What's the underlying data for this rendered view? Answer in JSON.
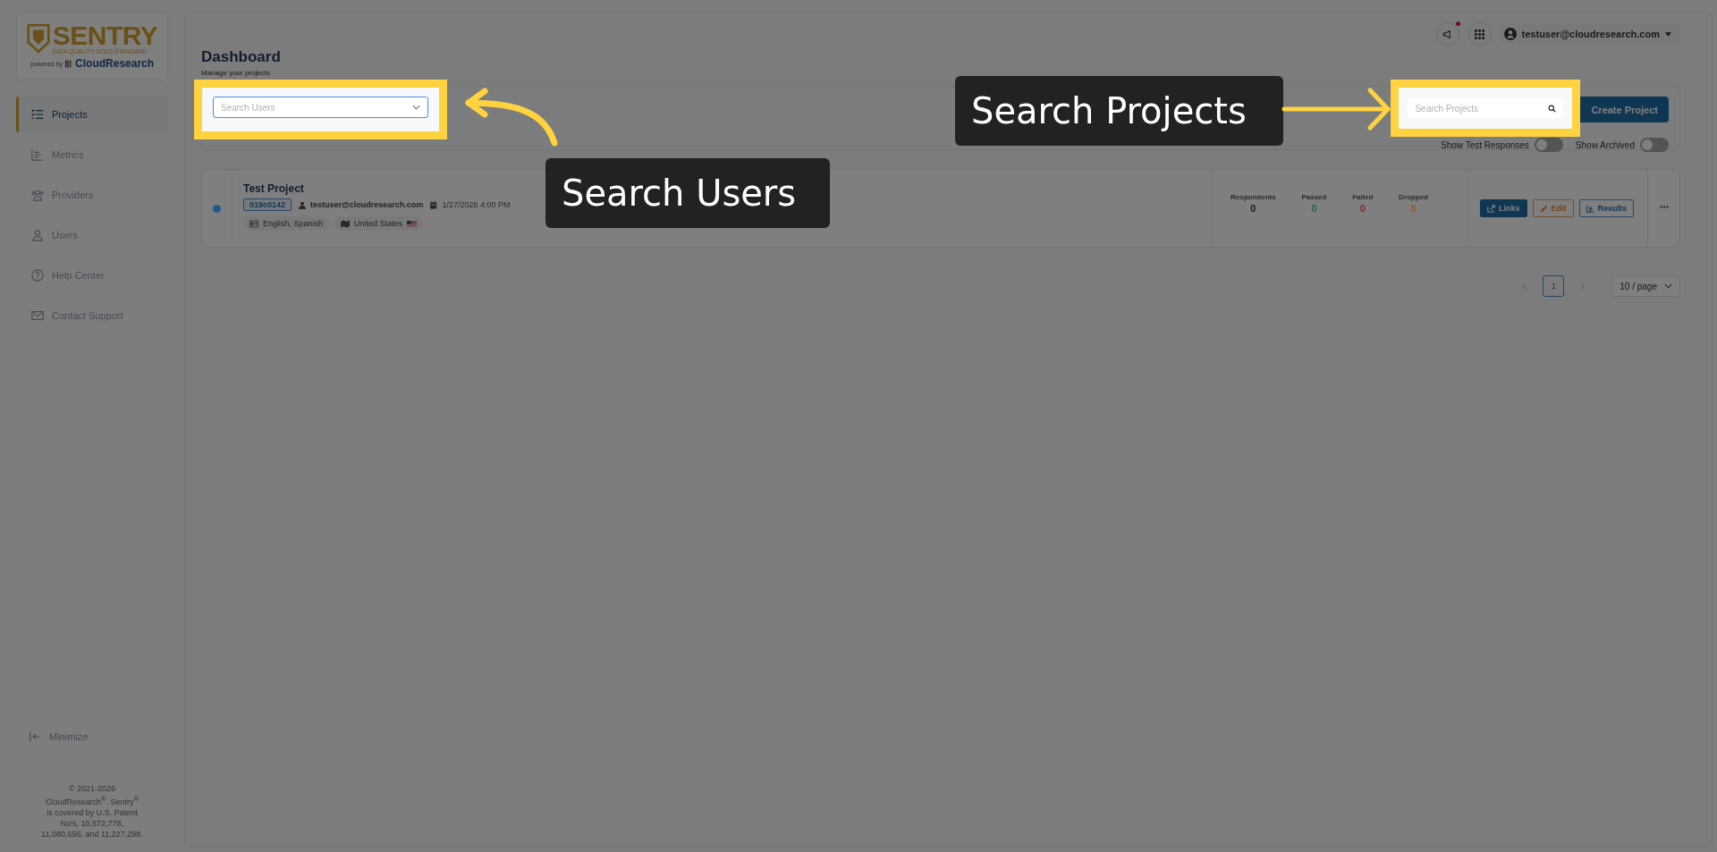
{
  "sidebar": {
    "logo": {
      "title": "SENTRY",
      "tagline": "DATA QUALITY GOLD STANDARD",
      "powered_by": "powered by",
      "brand": "CloudResearch"
    },
    "items": [
      {
        "label": "Projects",
        "selected": true,
        "kind": "list"
      },
      {
        "label": "Metrics",
        "selected": false,
        "kind": "chart"
      },
      {
        "label": "Providers",
        "selected": false,
        "kind": "group"
      },
      {
        "label": "Users",
        "selected": false,
        "kind": "user"
      },
      {
        "label": "Help Center",
        "selected": false,
        "kind": "help"
      },
      {
        "label": "Contact Support",
        "selected": false,
        "kind": "mail"
      }
    ],
    "minimize": "Minimize",
    "copyright": [
      "© 2021-2026",
      "CloudResearch$^{®}$. Sentry$^{®}$",
      "is covered by U.S. Patent",
      "No's, 10,572,778,",
      "11,080,656, and 11,227,298."
    ]
  },
  "header": {
    "has_notification": true,
    "user": "testuser@cloudresearch.com"
  },
  "page": {
    "title": "Dashboard",
    "subtitle": "Manage your projects"
  },
  "filters": {
    "user_select": {
      "placeholder": "Search Users"
    },
    "project_search": {
      "placeholder": "Search Projects"
    },
    "create_button": "Create Project",
    "toggles": [
      {
        "label": "Show Test Responses",
        "on": false
      },
      {
        "label": "Show Archived",
        "on": false
      }
    ]
  },
  "projects": [
    {
      "title": "Test Project",
      "color": "#1f5a8c",
      "code": "019c0142",
      "owner": "testuser@cloudresearch.com",
      "date": "1/27/2026 4:00 PM",
      "languages": "English, Spanish",
      "country": "United States",
      "stats": [
        {
          "label": "Respondents",
          "value": "0",
          "color": "#1a1a1a"
        },
        {
          "label": "Passed",
          "value": "0",
          "color": "#1f6b3e"
        },
        {
          "label": "Failed",
          "value": "0",
          "color": "#8f2424"
        },
        {
          "label": "Dropped",
          "value": "0",
          "color": "#9a5a20"
        }
      ],
      "actions": [
        {
          "label": "Links",
          "kind": "primary"
        },
        {
          "label": "Edit",
          "kind": "warning"
        },
        {
          "label": "Results",
          "kind": "outline"
        }
      ]
    }
  ],
  "pagination": {
    "pages": [
      {
        "label": "1",
        "selected": true
      }
    ],
    "page_size": "10 / page"
  },
  "callouts": [
    {
      "text": "Search Users",
      "kind": "left"
    },
    {
      "text": "Search Projects",
      "kind": "right"
    }
  ]
}
